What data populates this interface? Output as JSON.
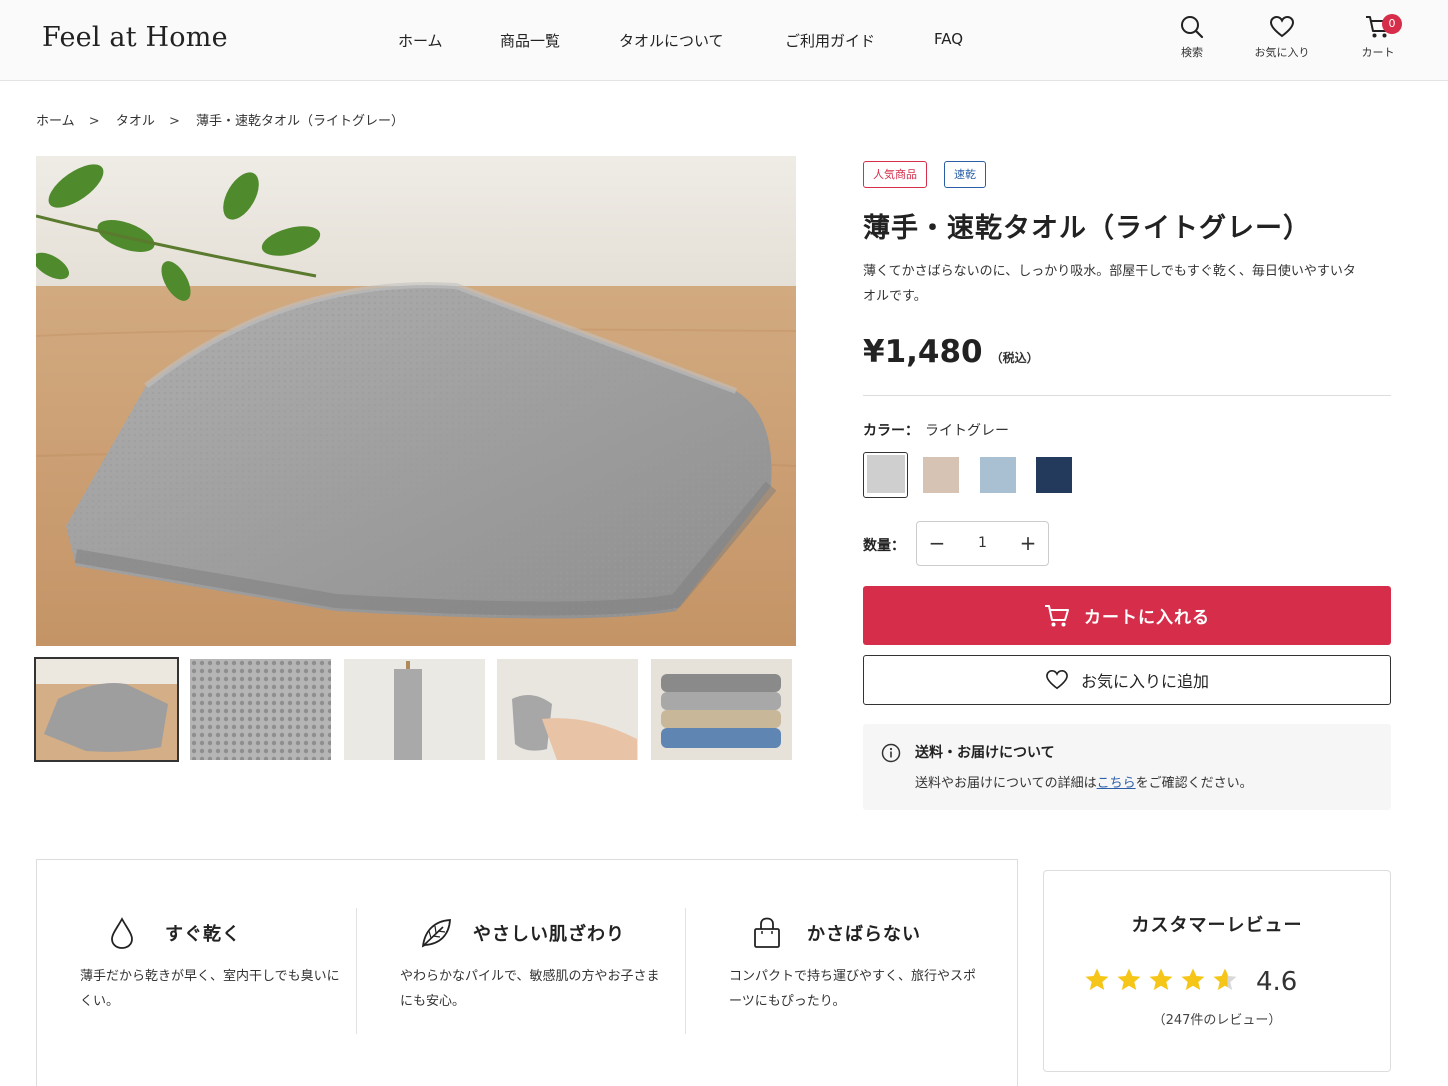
{
  "header": {
    "logo": "Feel at Home",
    "nav": [
      "ホーム",
      "商品一覧",
      "タオルについて",
      "ご利用ガイド",
      "FAQ"
    ],
    "icons": {
      "search": "検索",
      "favorites": "お気に入り",
      "cart": "カート",
      "cart_count": "0"
    }
  },
  "breadcrumb": [
    "ホーム",
    "タオル",
    "薄手・速乾タオル（ライトグレー）"
  ],
  "breadcrumb_sep": ">",
  "product": {
    "tags": [
      "人気商品",
      "速乾"
    ],
    "title": "薄手・速乾タオル（ライトグレー）",
    "description": "薄くてかさばらないのに、しっかり吸水。部屋干しでもすぐ乾く、毎日使いやすいタオルです。",
    "price": "¥1,480",
    "tax_note": "（税込）",
    "color_label": "カラー：",
    "color_value": "ライトグレー",
    "colors": [
      "#cfcfcf",
      "#d6c3b4",
      "#a9c0d2",
      "#233a5c"
    ],
    "quantity_label": "数量：",
    "quantity": "1",
    "minus": "−",
    "plus": "+",
    "add_to_cart": "カートに入れる",
    "add_favorite": "お気に入りに追加"
  },
  "shipping": {
    "title": "送料・お届けについて",
    "text_before": "送料やお届けについての詳細は",
    "link": "こちら",
    "text_after": "をご確認ください。"
  },
  "features": [
    {
      "icon": "water-drop-icon",
      "title": "すぐ乾く",
      "text": "薄手だから乾きが早く、室内干しでも臭いにくい。"
    },
    {
      "icon": "leaf-icon",
      "title": "やさしい肌ざわり",
      "text": "やわらかなパイルで、敏感肌の方やお子さまにも安心。"
    },
    {
      "icon": "bag-icon",
      "title": "かさばらない",
      "text": "コンパクトで持ち運びやすく、旅行やスポーツにもぴったり。"
    }
  ],
  "reviews": {
    "title": "カスタマーレビュー",
    "rating": 4.6,
    "score": "4.6",
    "count": "（247件のレビュー）"
  },
  "colors": {
    "accent": "#d62d4a",
    "link": "#2a5fa8",
    "star": "#f5c518"
  }
}
